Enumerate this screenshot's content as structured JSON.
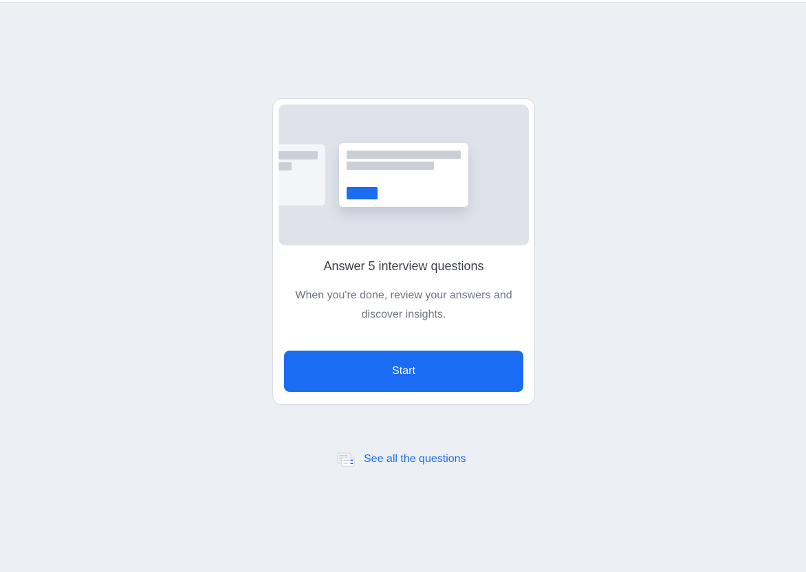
{
  "card": {
    "title": "Answer 5 interview questions",
    "description": "When you're done, review your answers and discover insights.",
    "start_label": "Start"
  },
  "footer_link": {
    "label": "See all the questions",
    "icon": "question-list-icon"
  },
  "colors": {
    "background": "#eceff4",
    "accent": "#1a6cf2",
    "card": "#ffffff",
    "illustration_bg": "#dfe2e9"
  }
}
